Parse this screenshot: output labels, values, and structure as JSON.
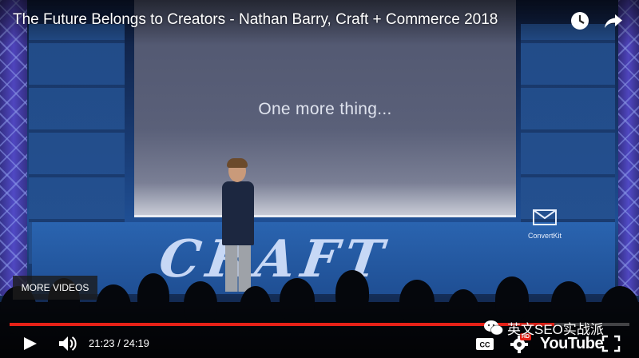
{
  "video": {
    "title": "The Future Belongs to Creators - Nathan Barry, Craft + Commerce 2018",
    "slide_text": "One more thing...",
    "stage_logo": "CRAFT",
    "sponsor_label": "ConvertKit"
  },
  "overlay": {
    "more_videos_label": "MORE VIDEOS"
  },
  "controls": {
    "time_display": "21:23 / 24:19",
    "progress_fraction": 0.8795,
    "hd_badge": "HD",
    "youtube_logo": "YouTube",
    "icons": [
      "play-icon",
      "volume-icon",
      "captions-icon",
      "settings-icon",
      "fullscreen-icon",
      "watch-later-icon",
      "share-icon"
    ]
  },
  "watermark": {
    "text": "英文SEO实战派"
  },
  "colors": {
    "progress": "#e62117",
    "slide_bg": "#575d75"
  }
}
